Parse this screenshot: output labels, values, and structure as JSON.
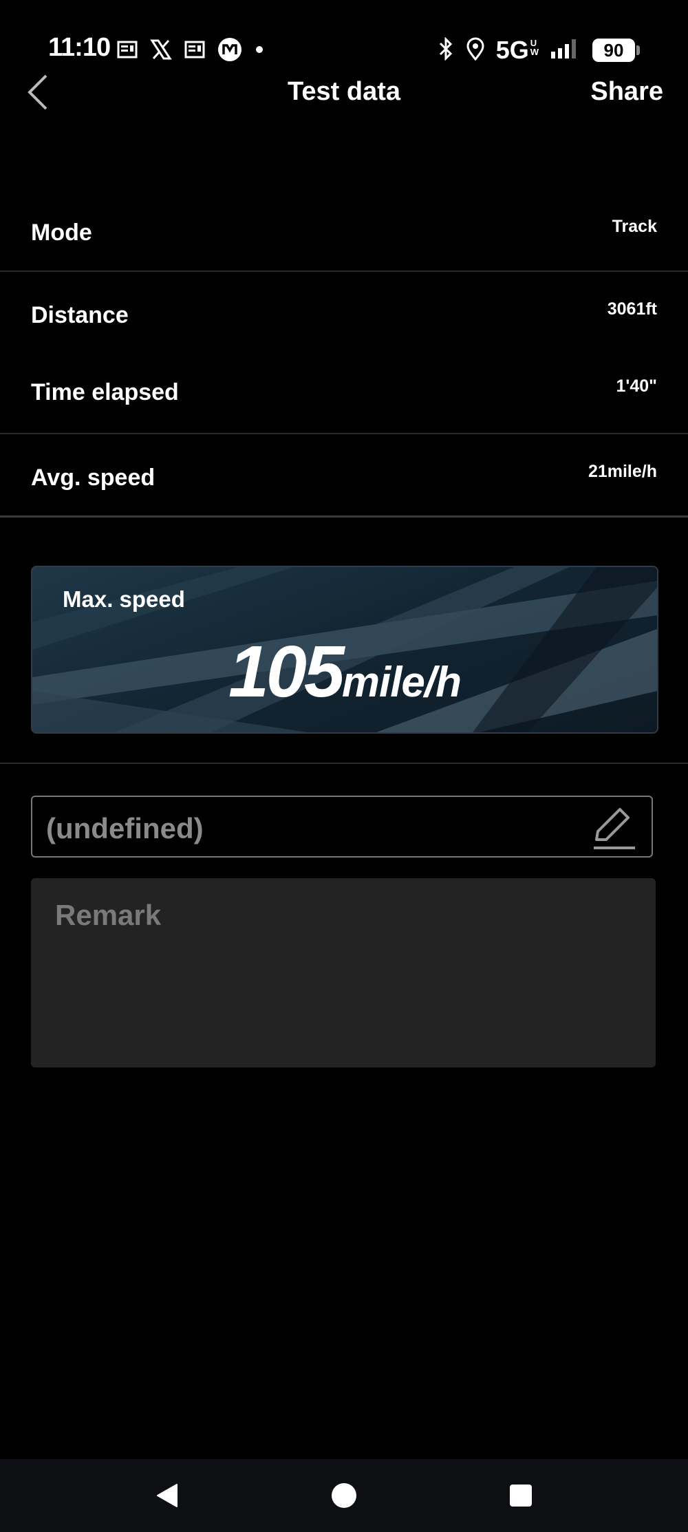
{
  "status_bar": {
    "time": "11:10",
    "network": "5G",
    "network_sub_top": "U",
    "network_sub_bottom": "W",
    "battery": "90",
    "left_icons": [
      "newspaper-icon",
      "x-logo-icon",
      "newspaper-icon",
      "m-logo-icon",
      "dot-icon"
    ],
    "right_icons": [
      "bluetooth-icon",
      "location-icon",
      "signal-icon"
    ]
  },
  "header": {
    "title": "Test data",
    "share_label": "Share",
    "back_icon": "chevron-left-icon"
  },
  "rows": [
    {
      "label": "Mode",
      "value": "Track"
    },
    {
      "label": "Distance",
      "value": "3061ft"
    },
    {
      "label": "Time elapsed",
      "value": "1'40\""
    },
    {
      "label": "Avg. speed",
      "value": "21mile/h"
    }
  ],
  "max_speed": {
    "label": "Max. speed",
    "value": "105",
    "unit": "mile/h"
  },
  "name_field": {
    "value": "(undefined)",
    "edit_icon": "pencil-icon"
  },
  "remark": {
    "placeholder": "Remark"
  },
  "colors": {
    "background": "#000000",
    "text": "#ffffff",
    "muted_text": "#8a8a8a",
    "remark_bg": "#232323",
    "card_bg": "#132634"
  }
}
